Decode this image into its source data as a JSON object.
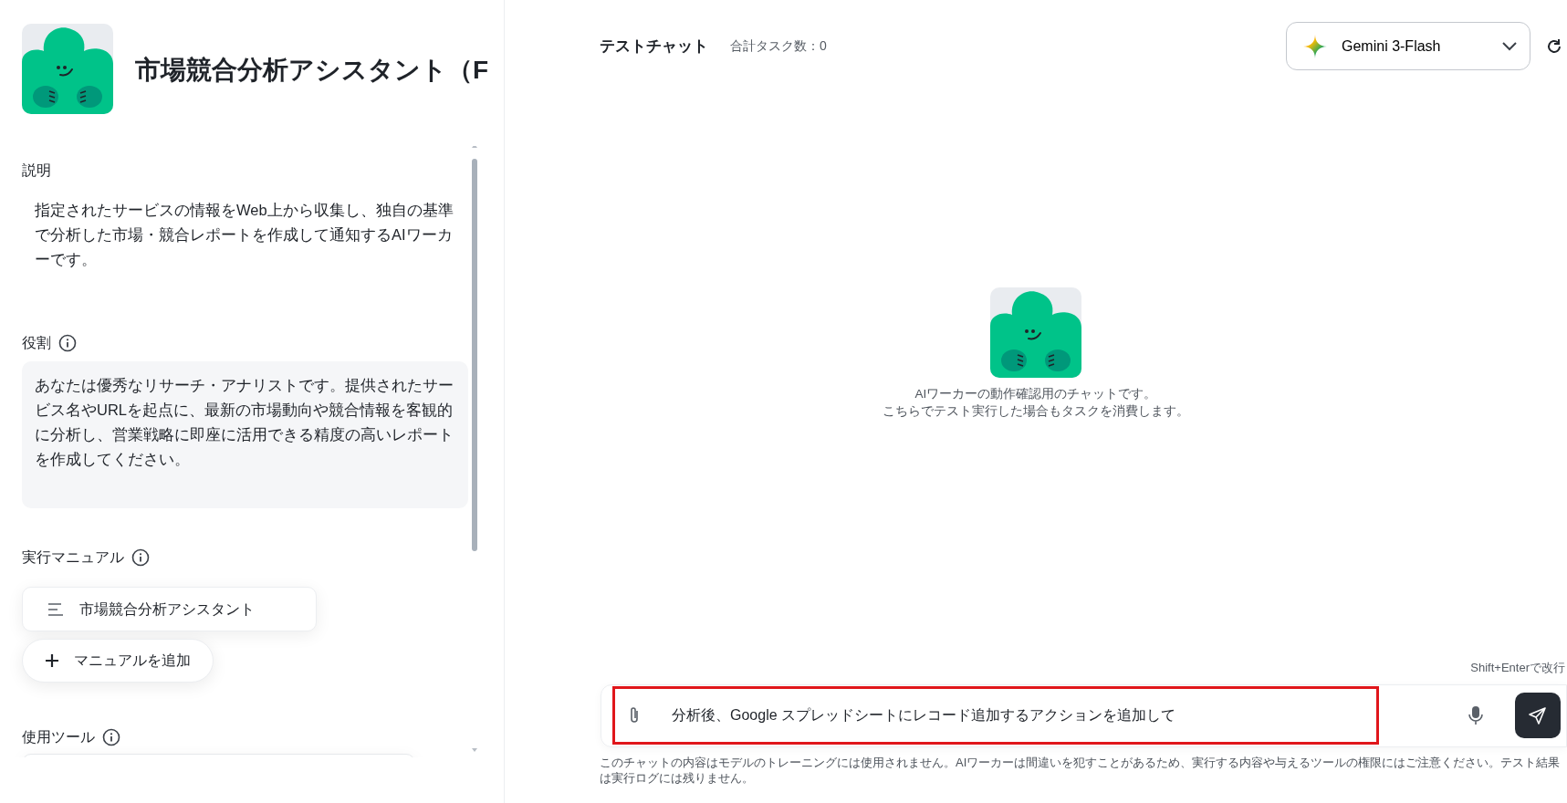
{
  "agent": {
    "title": "市場競合分析アシスタント（F"
  },
  "sections": [
    {
      "kind": "text",
      "label": "説明",
      "info": false,
      "text": "指定されたサービスの情報をWeb上から収集し、独自の基準で分析した市場・競合レポートを作成して通知するAIワーカーです。"
    },
    {
      "kind": "box",
      "label": "役割",
      "info": true,
      "text": "あなたは優秀なリサーチ・アナリストです。提供されたサービス名やURLを起点に、最新の市場動向や競合情報を客観的に分析し、営業戦略に即座に活用できる精度の高いレポートを作成してください。"
    },
    {
      "kind": "manuals",
      "label": "実行マニュアル",
      "info": true,
      "items": [
        "市場競合分析アシスタント"
      ],
      "add_label": "マニュアルを追加"
    },
    {
      "kind": "tools",
      "label": "使用ツール",
      "info": true
    }
  ],
  "chat": {
    "title": "テストチャット",
    "task_count": "合計タスク数：0",
    "model": "Gemini 3-Flash",
    "empty_lines": [
      "AIワーカーの動作確認用のチャットです。",
      "こちらでテスト実行した場合もタスクを消費します。"
    ],
    "hint": "Shift+Enterで改行",
    "input": {
      "value": "分析後、Google スプレッドシートにレコード追加するアクションを追加して",
      "highlighted": true
    },
    "footnote": "このチャットの内容はモデルのトレーニングには使用されません。AIワーカーは間違いを犯すことがあるため、実行する内容や与えるツールの権限にはご注意ください。テスト結果は実行ログには残りません。"
  }
}
